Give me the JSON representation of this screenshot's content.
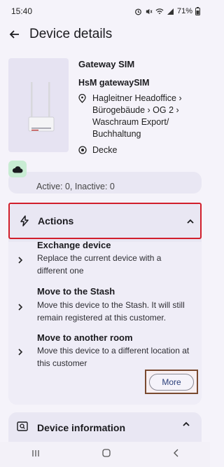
{
  "status_bar": {
    "time": "15:40",
    "battery": "71%"
  },
  "app_bar": {
    "title": "Device details"
  },
  "device": {
    "name": "Gateway SIM",
    "type": "HsM gatewaySIM",
    "location": "Hagleitner Headoffice › Bürogebäude › OG 2 › Waschraum Export/ Buchhaltung",
    "mount": "Decke"
  },
  "peek": {
    "text": "Active: 0, Inactive: 0"
  },
  "actions": {
    "title": "Actions",
    "items": [
      {
        "title": "Exchange device",
        "description": "Replace the current device with a different one"
      },
      {
        "title": "Move to the Stash",
        "description": "Move this device to the Stash. It will still remain registered at this customer."
      },
      {
        "title": "Move to another room",
        "description": "Move this device to a different location at this customer"
      }
    ],
    "more_label": "More"
  },
  "device_information": {
    "title": "Device information"
  },
  "icons": {
    "back": "arrow-back-icon",
    "location": "location-pin-icon",
    "mount": "target-icon",
    "cloud": "cloud-icon",
    "actions": "bolt-icon",
    "chevron": "chevron-up-icon",
    "item_arrow": "chevron-right-icon",
    "info": "search-icon"
  },
  "colors": {
    "highlight_red": "#d11f2c",
    "highlight_brown": "#7a4a30",
    "cloud_badge": "#c8ecd3",
    "accent": "#2b3f7a"
  }
}
